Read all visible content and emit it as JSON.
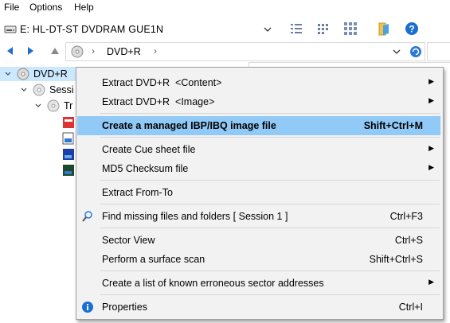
{
  "menubar": {
    "items": [
      "File",
      "Options",
      "Help"
    ]
  },
  "toolbar": {
    "drive_label": "E: HL-DT-ST  DVDRAM GUE1N",
    "icons": [
      "drive-icon",
      "chevron-down-icon",
      "details-view-icon",
      "list-view-icon",
      "grid-view-icon",
      "folder-icon",
      "help-icon"
    ]
  },
  "address": {
    "path": "DVD+R",
    "separator": "›"
  },
  "tree": {
    "root": "DVD+R",
    "session": "Sessi",
    "track": "Tr"
  },
  "context_menu": {
    "items": [
      {
        "label": "Extract DVD+R  <Content>",
        "shortcut": "",
        "submenu": true
      },
      {
        "label": "Extract DVD+R  <Image>",
        "shortcut": "",
        "submenu": true
      },
      {
        "label": "Create a managed IBP/IBQ image file",
        "shortcut": "Shift+Ctrl+M",
        "submenu": false,
        "highlighted": true
      },
      {
        "label": "Create Cue sheet file",
        "shortcut": "",
        "submenu": true
      },
      {
        "label": "MD5 Checksum file",
        "shortcut": "",
        "submenu": true
      },
      {
        "label": "Extract From-To",
        "shortcut": "",
        "submenu": false
      },
      {
        "label": "Find missing files and folders [ Session 1 ]",
        "shortcut": "Ctrl+F3",
        "submenu": false
      },
      {
        "label": "Sector View",
        "shortcut": "Ctrl+S",
        "submenu": false
      },
      {
        "label": "Perform a surface scan",
        "shortcut": "Shift+Ctrl+S",
        "submenu": false
      },
      {
        "label": "Create a list of known erroneous sector addresses",
        "shortcut": "",
        "submenu": true
      },
      {
        "label": "Properties",
        "shortcut": "Ctrl+I",
        "submenu": false
      }
    ],
    "submenu_arrow": "▶"
  },
  "colors": {
    "highlight": "#91c9f7",
    "menu_bg": "#f2f2f2",
    "accent_blue": "#1a6fd1"
  }
}
